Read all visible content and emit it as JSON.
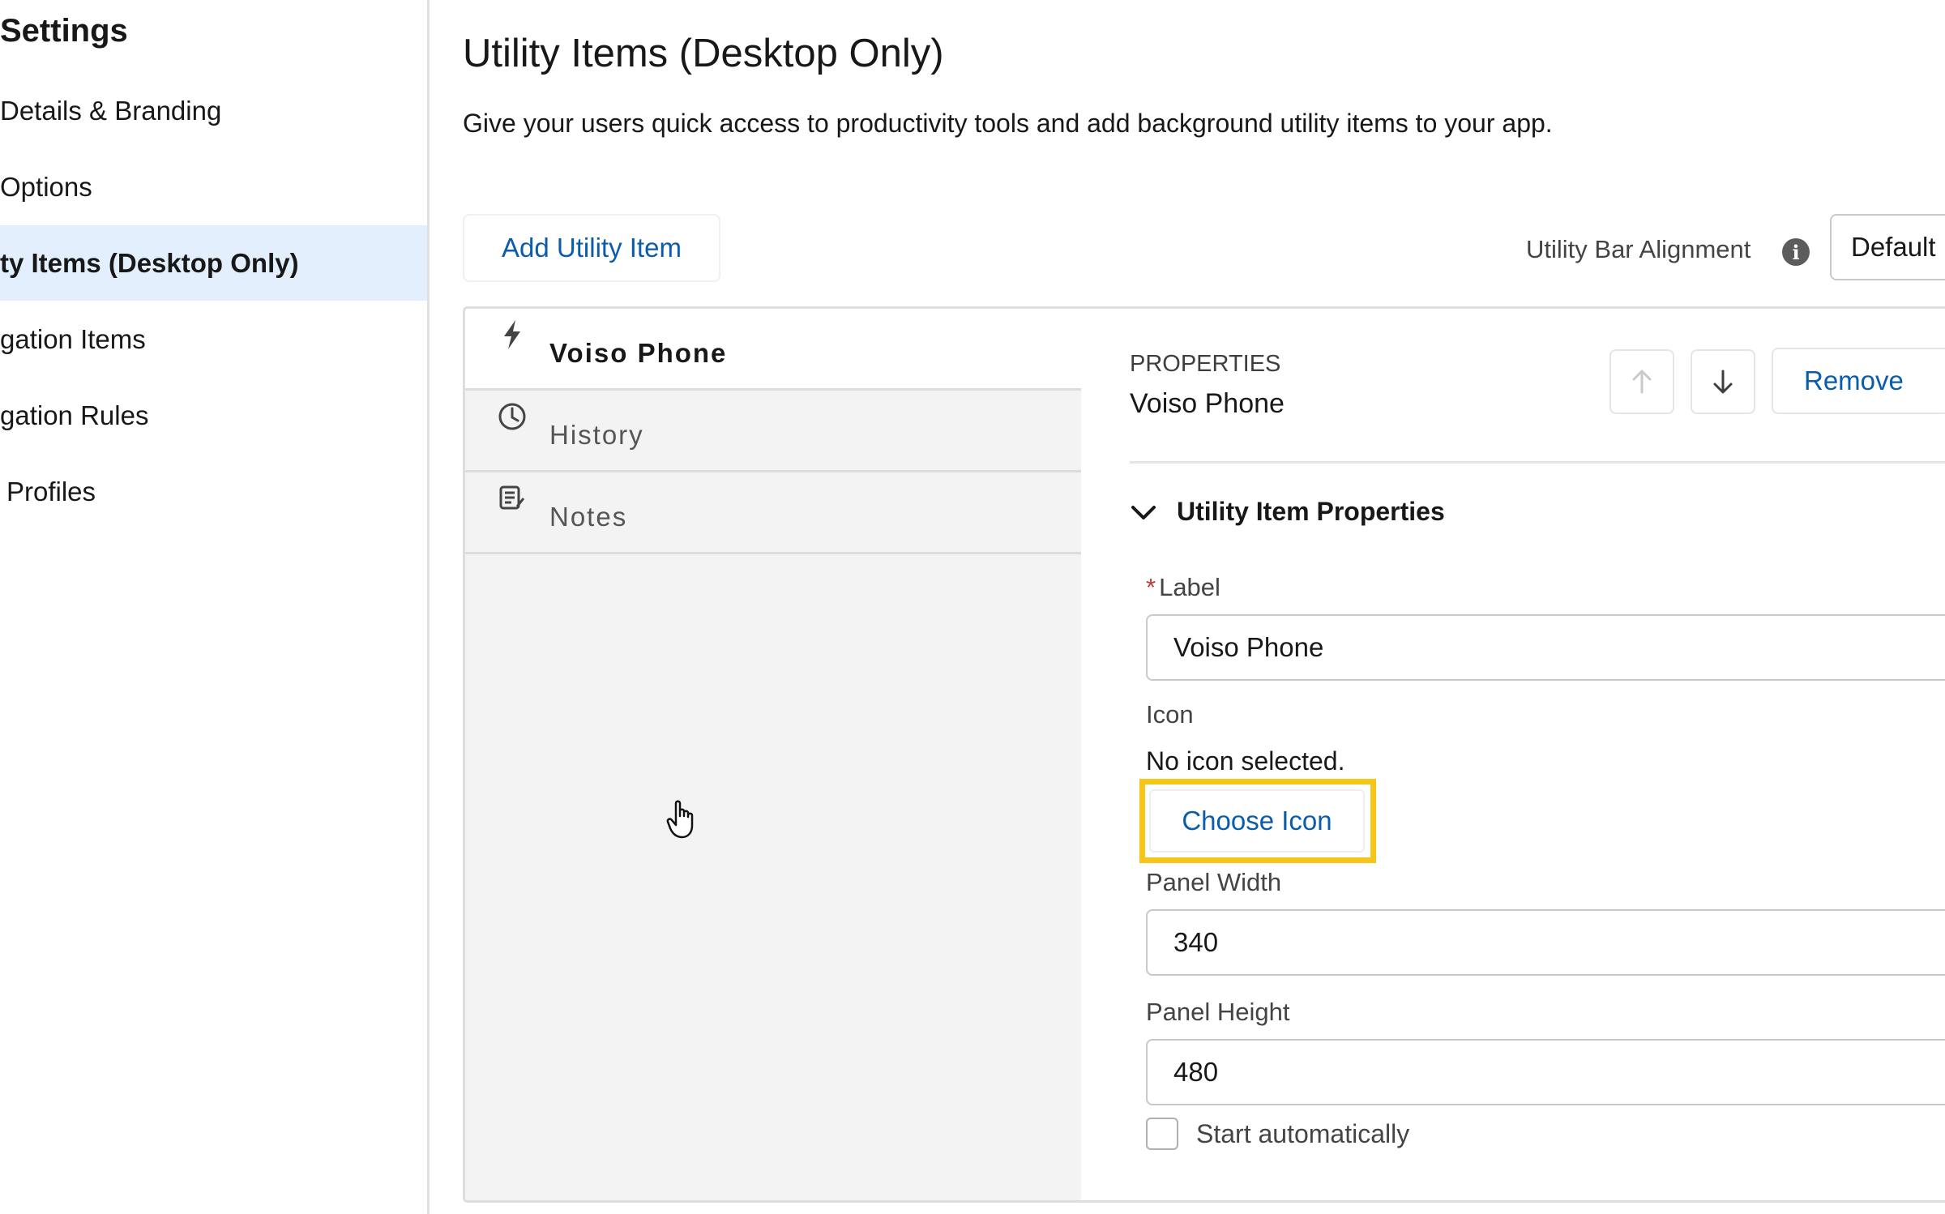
{
  "sidebar": {
    "title": "Settings",
    "items": [
      {
        "label": "Details & Branding"
      },
      {
        "label": "Options"
      },
      {
        "label": "ty Items (Desktop Only)"
      },
      {
        "label": "gation Items"
      },
      {
        "label": "gation Rules"
      },
      {
        "label": "Profiles"
      }
    ]
  },
  "main": {
    "title": "Utility Items (Desktop Only)",
    "description": "Give your users quick access to productivity tools and add background utility items to your app.",
    "add_button": "Add Utility Item",
    "alignment_label": "Utility Bar Alignment",
    "alignment_value": "Default"
  },
  "utility_list": [
    {
      "label": "Voiso Phone",
      "icon": "lightning-icon"
    },
    {
      "label": "History",
      "icon": "clock-icon"
    },
    {
      "label": "Notes",
      "icon": "notes-icon"
    }
  ],
  "properties": {
    "eyebrow": "PROPERTIES",
    "name": "Voiso Phone",
    "remove_label": "Remove",
    "section_title": "Utility Item Properties",
    "label_field": {
      "required_mark": "*",
      "label": "Label",
      "value": "Voiso Phone"
    },
    "icon_field": {
      "label": "Icon",
      "status": "No icon selected.",
      "button": "Choose Icon"
    },
    "panel_width": {
      "label": "Panel Width",
      "value": "340"
    },
    "panel_height": {
      "label": "Panel Height",
      "value": "480"
    },
    "start_auto": {
      "label": "Start automatically",
      "checked": false
    }
  },
  "colors": {
    "brand": "#0b5cab",
    "active_bg": "#e3effd",
    "highlight": "#f5c518"
  }
}
